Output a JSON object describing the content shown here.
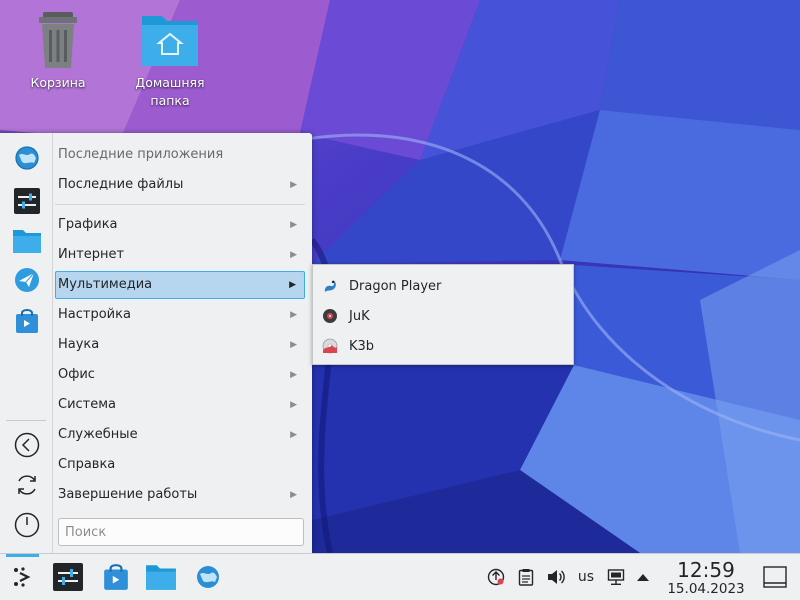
{
  "desktop": {
    "trash_label": "Корзина",
    "home_label": "Домашняя папка"
  },
  "menu": {
    "recent_apps": "Последние приложения",
    "recent_files": "Последние файлы",
    "categories": [
      {
        "label": "Графика"
      },
      {
        "label": "Интернет"
      },
      {
        "label": "Мультимедиа"
      },
      {
        "label": "Настройка"
      },
      {
        "label": "Наука"
      },
      {
        "label": "Офис"
      },
      {
        "label": "Система"
      },
      {
        "label": "Служебные"
      },
      {
        "label": "Справка"
      },
      {
        "label": "Завершение работы"
      }
    ],
    "search_placeholder": "Поиск",
    "active_category": "Мультимедиа"
  },
  "submenu": {
    "items": [
      {
        "label": "Dragon Player",
        "icon": "dragon-player-icon"
      },
      {
        "label": "JuK",
        "icon": "juk-icon"
      },
      {
        "label": "K3b",
        "icon": "k3b-icon"
      }
    ]
  },
  "taskbar": {
    "keyboard_layout": "us",
    "clock_time": "12:59",
    "clock_date": "15.04.2023"
  },
  "colors": {
    "accent": "#3daee9",
    "highlight": "#b6d5ee",
    "panel_bg": "#eff0f1"
  }
}
